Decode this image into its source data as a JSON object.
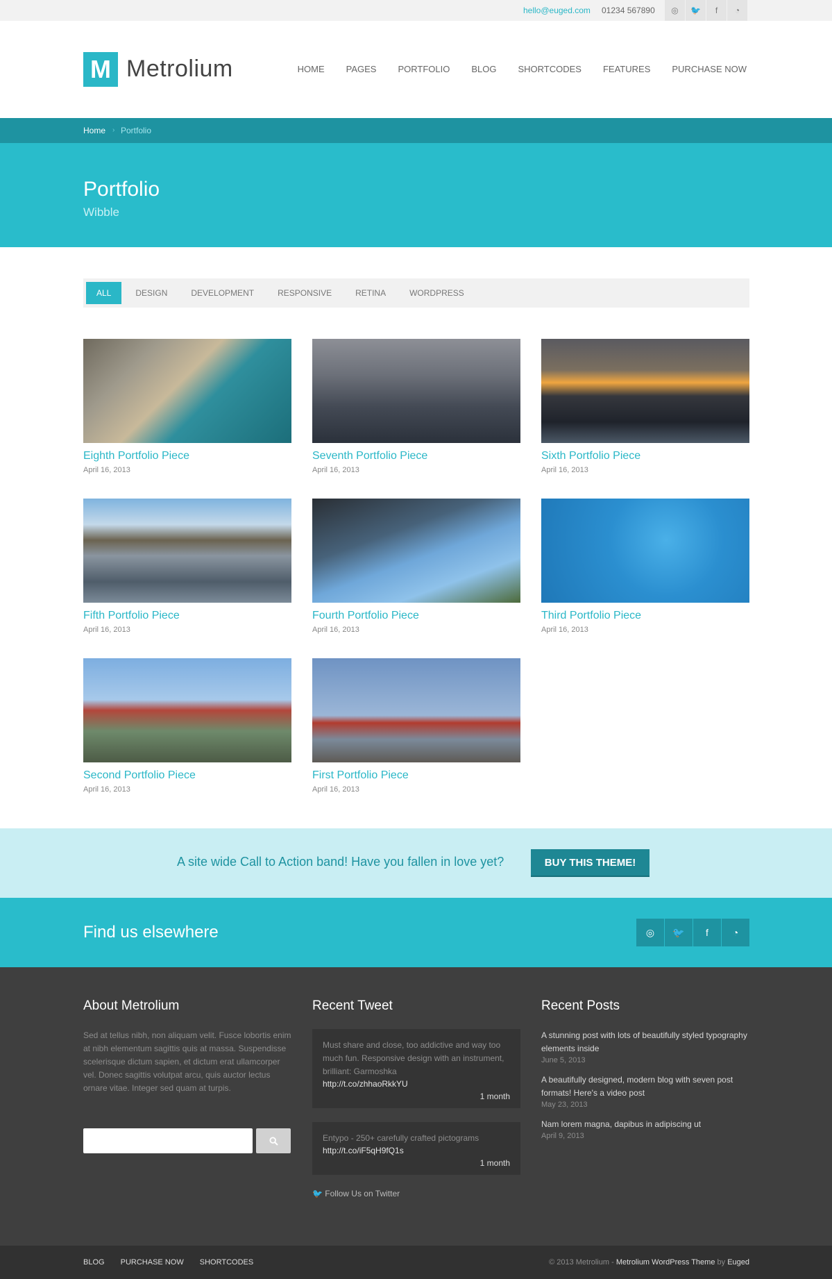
{
  "topbar": {
    "email": "hello@euged.com",
    "phone": "01234 567890",
    "icons": [
      "dribbble-icon",
      "twitter-icon",
      "facebook-icon",
      "rss-icon"
    ]
  },
  "header": {
    "logo_letter": "M",
    "logo_text": "Metrolium",
    "nav": [
      "HOME",
      "PAGES",
      "PORTFOLIO",
      "BLOG",
      "SHORTCODES",
      "FEATURES",
      "PURCHASE NOW"
    ]
  },
  "breadcrumb": {
    "home": "Home",
    "separator": "›",
    "current": "Portfolio"
  },
  "page": {
    "title": "Portfolio",
    "subtitle": "Wibble"
  },
  "filters": [
    "ALL",
    "DESIGN",
    "DEVELOPMENT",
    "RESPONSIVE",
    "RETINA",
    "WORDPRESS"
  ],
  "portfolio": [
    {
      "title": "Eighth Portfolio Piece",
      "date": "April 16, 2013"
    },
    {
      "title": "Seventh Portfolio Piece",
      "date": "April 16, 2013"
    },
    {
      "title": "Sixth Portfolio Piece",
      "date": "April 16, 2013"
    },
    {
      "title": "Fifth Portfolio Piece",
      "date": "April 16, 2013"
    },
    {
      "title": "Fourth Portfolio Piece",
      "date": "April 16, 2013"
    },
    {
      "title": "Third Portfolio Piece",
      "date": "April 16, 2013"
    },
    {
      "title": "Second Portfolio Piece",
      "date": "April 16, 2013"
    },
    {
      "title": "First Portfolio Piece",
      "date": "April 16, 2013"
    }
  ],
  "cta": {
    "text": "A site wide Call to Action band! Have you fallen in love yet?",
    "button": "BUY THIS THEME!"
  },
  "findus": {
    "title": "Find us elsewhere",
    "icons": [
      "dribbble-icon",
      "twitter-icon",
      "facebook-icon",
      "rss-icon"
    ]
  },
  "footer": {
    "about": {
      "title": "About Metrolium",
      "text": "Sed at tellus nibh, non aliquam velit. Fusce lobortis enim at nibh elementum sagittis quis at massa. Suspendisse scelerisque dictum sapien, et dictum erat ullamcorper vel. Donec sagittis volutpat arcu, quis auctor lectus ornare vitae. Integer sed quam at turpis."
    },
    "tweets": {
      "title": "Recent Tweet",
      "items": [
        {
          "text": "Must share and close, too addictive and way too much fun. Responsive design with an instrument, brilliant: Garmoshka",
          "link": "http://t.co/zhhaoRkkYU",
          "when": "1 month"
        },
        {
          "text": "Entypo - 250+ carefully crafted pictograms",
          "link": "http://t.co/iF5qH9fQ1s",
          "when": "1 month"
        }
      ],
      "follow": "Follow Us on Twitter"
    },
    "posts": {
      "title": "Recent Posts",
      "items": [
        {
          "title": "A stunning post with lots of beautifully styled typography elements inside",
          "date": "June 5, 2013"
        },
        {
          "title": "A beautifully designed, modern blog with seven post formats! Here's a video post",
          "date": "May 23, 2013"
        },
        {
          "title": "Nam lorem magna, dapibus in adipiscing ut",
          "date": "April 9, 2013"
        }
      ]
    }
  },
  "bottombar": {
    "links": [
      "BLOG",
      "PURCHASE NOW",
      "SHORTCODES"
    ],
    "copy_prefix": "© 2013 Metrolium - ",
    "copy_theme": "Metrolium WordPress Theme",
    "copy_by": " by ",
    "copy_author": "Euged"
  }
}
